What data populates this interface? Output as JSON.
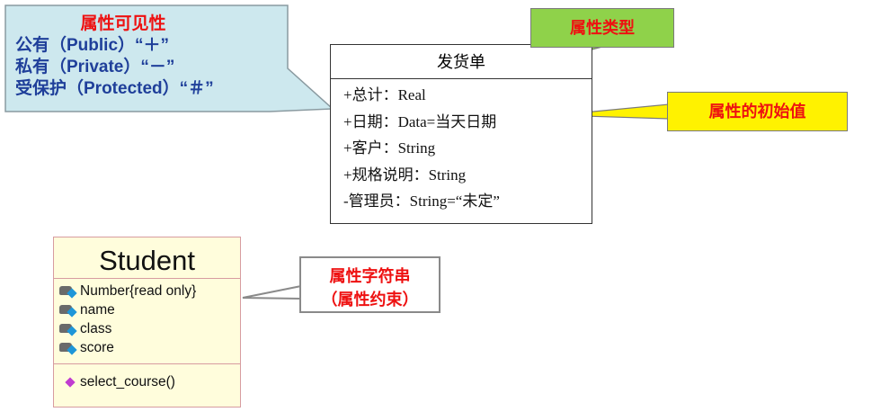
{
  "visibility_callout": {
    "title": "属性可见性",
    "lines": [
      "公有（Public）“＋”",
      "私有（Private）“－”",
      "受保护（Protected）“＃”"
    ]
  },
  "invoice_class": {
    "name": "发货单",
    "attributes": [
      "+总计：Real",
      "+日期：Data=当天日期",
      "+客户：String",
      "+规格说明：String",
      "-管理员：String=“未定”"
    ]
  },
  "type_label": "属性类型",
  "initial_value_label": "属性的初始值",
  "student_class": {
    "name": "Student",
    "attributes": [
      "Number{read only}",
      "name",
      "class",
      "score"
    ],
    "operations": [
      "select_course()"
    ]
  },
  "string_callout": {
    "line1": "属性字符串",
    "line2": "（属性约束）"
  },
  "colors": {
    "callout_fill": "#cde8ee",
    "type_fill": "#8fd24a",
    "init_fill": "#fff200",
    "label_red": "#ee1111",
    "blue_text": "#1f3f9a",
    "student_fill": "#fffddc"
  }
}
